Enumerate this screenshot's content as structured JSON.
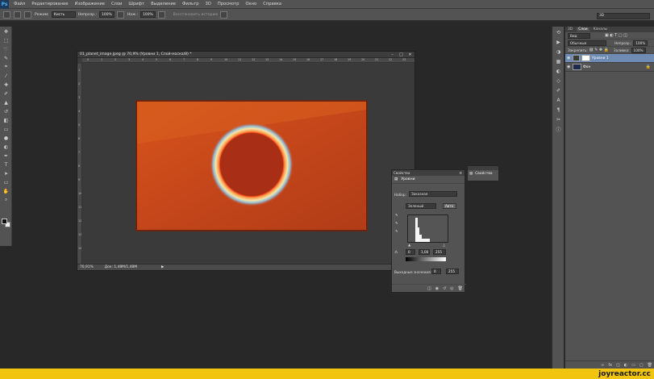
{
  "app": {
    "logo": "Ps",
    "workspace": "3D"
  },
  "menu": [
    "Файл",
    "Редактирование",
    "Изображение",
    "Слои",
    "Шрифт",
    "Выделение",
    "Фильтр",
    "3D",
    "Просмотр",
    "Окно",
    "Справка"
  ],
  "options": {
    "mode_label": "Режим:",
    "mode_value": "Кисть",
    "opacity_label": "Непрозр.:",
    "opacity_value": "100%",
    "flow_label": "Наж.:",
    "flow_value": "100%",
    "erase_history": "Восстановить историю"
  },
  "tools": [
    "move-icon",
    "marquee-icon",
    "lasso-icon",
    "quick-select-icon",
    "crop-icon",
    "eyedropper-icon",
    "healing-icon",
    "brush-icon",
    "stamp-icon",
    "history-brush-icon",
    "eraser-icon",
    "gradient-icon",
    "blur-icon",
    "dodge-icon",
    "pen-icon",
    "type-icon",
    "path-select-icon",
    "shape-icon",
    "hand-icon",
    "zoom-icon"
  ],
  "document": {
    "title": "01_planet_image.jpeg @ 70,9% (Уровни 1, Слой-маска/8) *",
    "zoom": "70,91%",
    "doc_size": "Док: 1,48M/1,48M",
    "ruler_h": [
      "0",
      "1",
      "2",
      "3",
      "4",
      "5",
      "6",
      "7",
      "8",
      "9",
      "10",
      "11",
      "12",
      "13",
      "14",
      "15",
      "16",
      "17",
      "18",
      "19",
      "20",
      "21",
      "22",
      "23"
    ],
    "ruler_v": [
      "1",
      "2",
      "3",
      "4",
      "5",
      "6",
      "7",
      "8",
      "9",
      "10",
      "11",
      "12",
      "13",
      "14"
    ]
  },
  "layers_panel": {
    "tabs": [
      "3D",
      "Слои",
      "Каналы"
    ],
    "kind": "Вид",
    "blend_mode": "Обычные",
    "opacity_label": "Непрозр.:",
    "opacity_value": "100%",
    "lock_label": "Закрепить:",
    "fill_label": "Заливка:",
    "fill_value": "100%",
    "layers": [
      {
        "name": "Уровни 1",
        "selected": true
      },
      {
        "name": "Фон",
        "selected": false
      }
    ]
  },
  "properties_panel": {
    "title": "Свойства",
    "subtitle": "Уровни",
    "preset_label": "Набор:",
    "preset_value": "Заказная",
    "channel_value": "Зеленый",
    "auto_button": "Авто",
    "input_black": "0",
    "input_gamma": "1,00",
    "input_white": "255",
    "output_label": "Выходные значения:",
    "output_black": "0",
    "output_white": "255"
  },
  "mini_panel": {
    "label": "Свойства"
  },
  "footer": {
    "brand": "joyreactor.cc"
  },
  "colors": {
    "accent_orange": "#c94a1a",
    "panel": "#535353",
    "banner": "#f1c40f"
  }
}
